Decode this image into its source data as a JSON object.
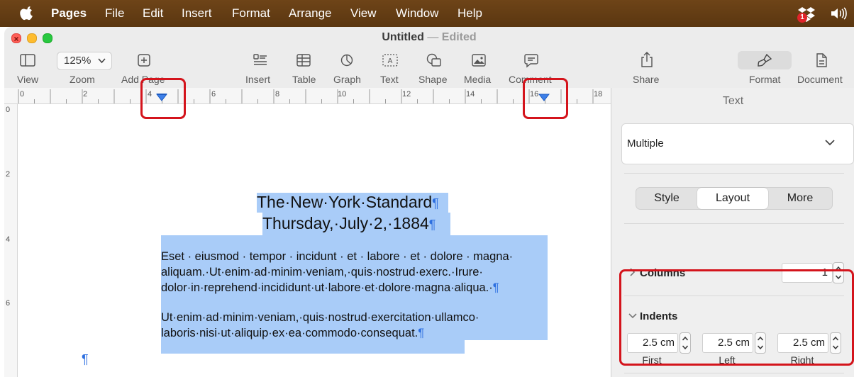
{
  "menubar": {
    "app": "Pages",
    "items": [
      "File",
      "Edit",
      "Insert",
      "Format",
      "Arrange",
      "View",
      "Window",
      "Help"
    ],
    "dropbox_badge": "1"
  },
  "window": {
    "title": "Untitled",
    "separator": "—",
    "status": "Edited"
  },
  "toolbar": {
    "view_label": "View",
    "zoom_value": "125%",
    "zoom_label": "Zoom",
    "add_page_label": "Add Page",
    "insert_label": "Insert",
    "table_label": "Table",
    "graph_label": "Graph",
    "text_label": "Text",
    "shape_label": "Shape",
    "media_label": "Media",
    "comment_label": "Comment",
    "share_label": "Share",
    "format_label": "Format",
    "document_label": "Document"
  },
  "ruler": {
    "h_numbers": [
      "0",
      "2",
      "4",
      "6",
      "8",
      "10",
      "12",
      "14",
      "16",
      "18"
    ],
    "v_numbers": [
      "0",
      "2",
      "4",
      "6"
    ]
  },
  "document": {
    "title_line1": "The·New·York·Standard",
    "title_line2": "Thursday,·July·2,·1884",
    "para1_line1": "Eset · eiusmod · tempor · incidunt · et · labore · et · dolore · magna·",
    "para1_line2": "aliquam.·Ut·enim·ad·minim·veniam,·quis·nostrud·exerc.·Irure·",
    "para1_line3": "dolor·in·reprehend·incididunt·ut·labore·et·dolore·magna·aliqua.·",
    "para2_line1": "Ut·enim·ad·minim·veniam,·quis·nostrud·exercitation·ullamco·",
    "para2_line2": "laboris·nisi·ut·aliquip·ex·ea·commodo·consequat.",
    "pilcrow": "¶"
  },
  "sidebar": {
    "title": "Text",
    "style_select": "Multiple",
    "tabs": [
      "Style",
      "Layout",
      "More"
    ],
    "active_tab": "Layout",
    "columns_label": "Columns",
    "columns_value": "1",
    "indents_label": "Indents",
    "indent_first": "2.5 cm",
    "indent_left": "2.5 cm",
    "indent_right": "2.5 cm",
    "first_label": "First",
    "left_label": "Left",
    "right_label": "Right"
  },
  "colors": {
    "highlight": "#a9ccf8",
    "annotation": "#d4141c",
    "menubar": "#5f3a12"
  }
}
